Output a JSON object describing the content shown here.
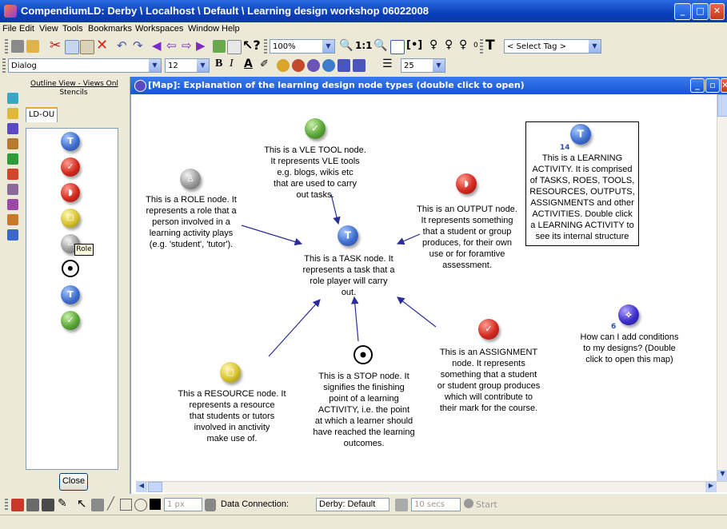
{
  "window": {
    "title": "CompendiumLD: Derby \\ Localhost \\ Default \\ Learning design workshop 06022008"
  },
  "menu": [
    "File",
    "Edit",
    "View",
    "Tools",
    "Bookmarks",
    "Workspaces",
    "Window",
    "Help"
  ],
  "toolbar1": {
    "zoom": "100%",
    "zoom_11": "1:1",
    "select_tag": "< Select Tag >",
    "tag_counter": "0"
  },
  "toolbar2": {
    "font_family": "Dialog",
    "font_size": "12",
    "bold": "B",
    "italic": "I",
    "underline": "A",
    "wrap_width": "25"
  },
  "outline_panel": {
    "header": "Outline View - Views Only",
    "stencils_label": "Stencils",
    "tab": "LD-OU",
    "tooltip": "Role",
    "close_button": "Close"
  },
  "map": {
    "title": "[Map]: Explanation of the learning design node types (double click to open)",
    "nodes": {
      "vle": "This is a VLE TOOL node.\nIt represents VLE tools\ne.g. blogs, wikis etc\nthat are used to carry\nout tasks.",
      "role": "This is a ROLE node. It\nrepresents a role that a\nperson involved in a\nlearning activity plays\n(e.g. 'student', 'tutor').",
      "task": "This is a TASK node. It\nrepresents a task that a\nrole player will carry\nout.",
      "output": "This is an OUTPUT node.\nIt represents something\nthat a student or group\nproduces, for their own\nuse or  for foramtive\nassessment.",
      "learning_activity_count": "14",
      "learning_activity": "This is a LEARNING\nACTIVITY. It is comprised\nof TASKS, ROES, TOOLS,\nRESOURCES, OUTPUTS,\nASSIGNMENTS and other\nACTIVITIES. Double click\na LEARNING ACTIVITY to\nsee its internal structure",
      "map_count": "6",
      "map_link": "How can I add conditions\nto my designs? (Double\nclick to open this map)",
      "resource": "This a RESOURCE node. It\nrepresents a resource\nthat students or tutors\ninvolved in anctivity\nmake use of.",
      "stop": "This is a STOP node. It\nsignifies the finishing\npoint of a learning\nACTIVITY, i.e. the point\nat which a learner should\nhave reached the learning\noutcomes.",
      "assignment": "This is an ASSIGNMENT\nnode. It represents\nsomething that a student\nor student group produces\nwhich will contribute to\ntheir mark for the course."
    }
  },
  "statusbar": {
    "line_width": "1 px",
    "data_connection_label": "Data Connection:",
    "data_connection_value": "Derby: Default",
    "interval": "10 secs",
    "start": "Start"
  },
  "colors": {
    "title_bar": "#0a3fb8",
    "panel_bg": "#ece9d8",
    "map_title": "#1755d4",
    "arrow": "#2a2d9a"
  }
}
